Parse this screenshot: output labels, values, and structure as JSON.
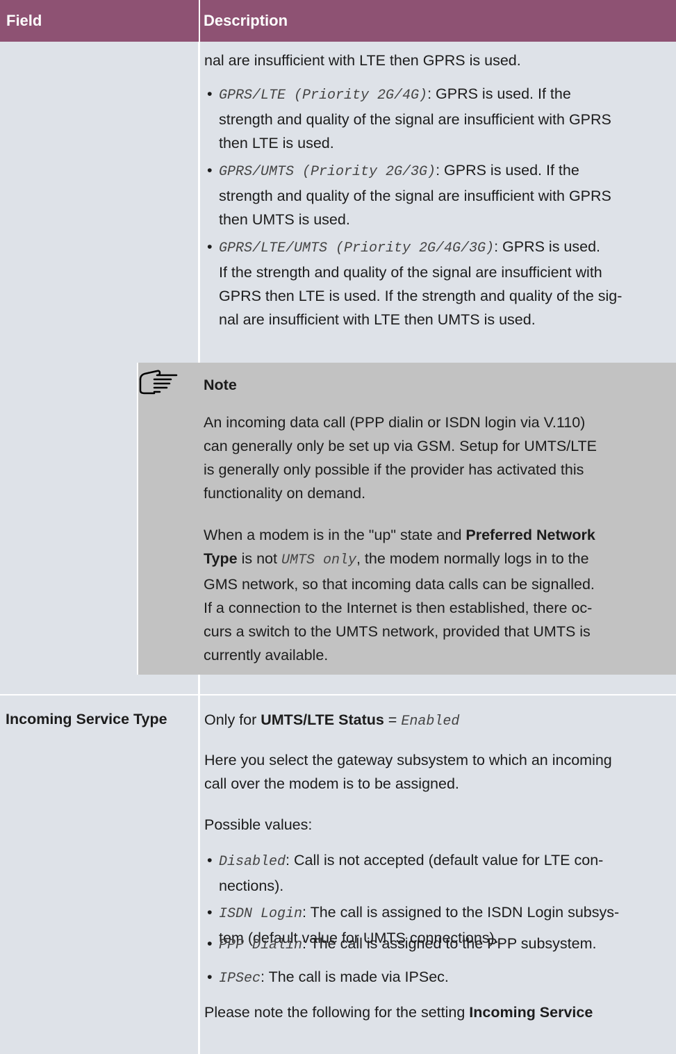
{
  "header": {
    "field": "Field",
    "description": "Description"
  },
  "cont": {
    "intro": "nal are insufficient with LTE then GPRS is used.",
    "bullets": [
      {
        "code": "GPRS/LTE (Priority 2G/4G)",
        "lines": [
          ": GPRS is used. If the",
          "strength and quality of the signal are insufficient with GPRS",
          "then LTE is used."
        ]
      },
      {
        "code": "GPRS/UMTS (Priority 2G/3G)",
        "lines": [
          ": GPRS is used. If the",
          "strength and quality of the signal are insufficient with GPRS",
          "then UMTS is used."
        ]
      },
      {
        "code": "GPRS/LTE/UMTS (Priority 2G/4G/3G)",
        "lines": [
          ": GPRS is used.",
          "If the strength and quality of the signal are insufficient with",
          "GPRS then LTE is used. If the strength and quality of the sig-",
          "nal are insufficient with LTE then UMTS is used."
        ]
      }
    ]
  },
  "note": {
    "title": "Note",
    "p1": [
      "An incoming data call (PPP dialin or ISDN login via V.110)",
      "can generally only be set up via GSM. Setup for UMTS/LTE",
      "is generally only possible if the provider has activated this",
      "functionality on demand."
    ],
    "p2_line1_pre": "When a modem is in the \"up\" state and ",
    "p2_line1_bold": "Preferred Network",
    "p2_line2_bold": "Type",
    "p2_line2_mid": " is not ",
    "p2_line2_code": "UMTS only",
    "p2_line2_post": ", the modem normally logs in to the",
    "p2_rest": [
      "GMS network, so that incoming data calls can be signalled.",
      "If a connection to the Internet is then established, there oc-",
      "curs a switch to the UMTS network, provided that UMTS is",
      "currently available."
    ]
  },
  "row2": {
    "field": "Incoming Service Type",
    "only_pre": "Only for ",
    "only_bold": "UMTS/LTE Status",
    "only_eq": " = ",
    "only_code": "Enabled",
    "select": [
      "Here you select the gateway subsystem to which an incoming",
      "call over the modem is to be assigned."
    ],
    "possible": "Possible values:",
    "values": [
      {
        "code": "Disabled",
        "lines": [
          ": Call is not accepted (default value for LTE con-",
          "nections)."
        ]
      },
      {
        "code": "ISDN Login",
        "lines": [
          ": The call is assigned to the ISDN Login subsys-",
          "tem (default value for UMTS connections)."
        ]
      },
      {
        "code": "PPP Dialin",
        "lines": [
          ": The call is assigned to the PPP subsystem."
        ]
      },
      {
        "code": "IPSec",
        "lines": [
          ": The call is made via IPSec."
        ]
      }
    ],
    "final_pre": "Please note the following for the setting ",
    "final_bold": "Incoming Service"
  }
}
